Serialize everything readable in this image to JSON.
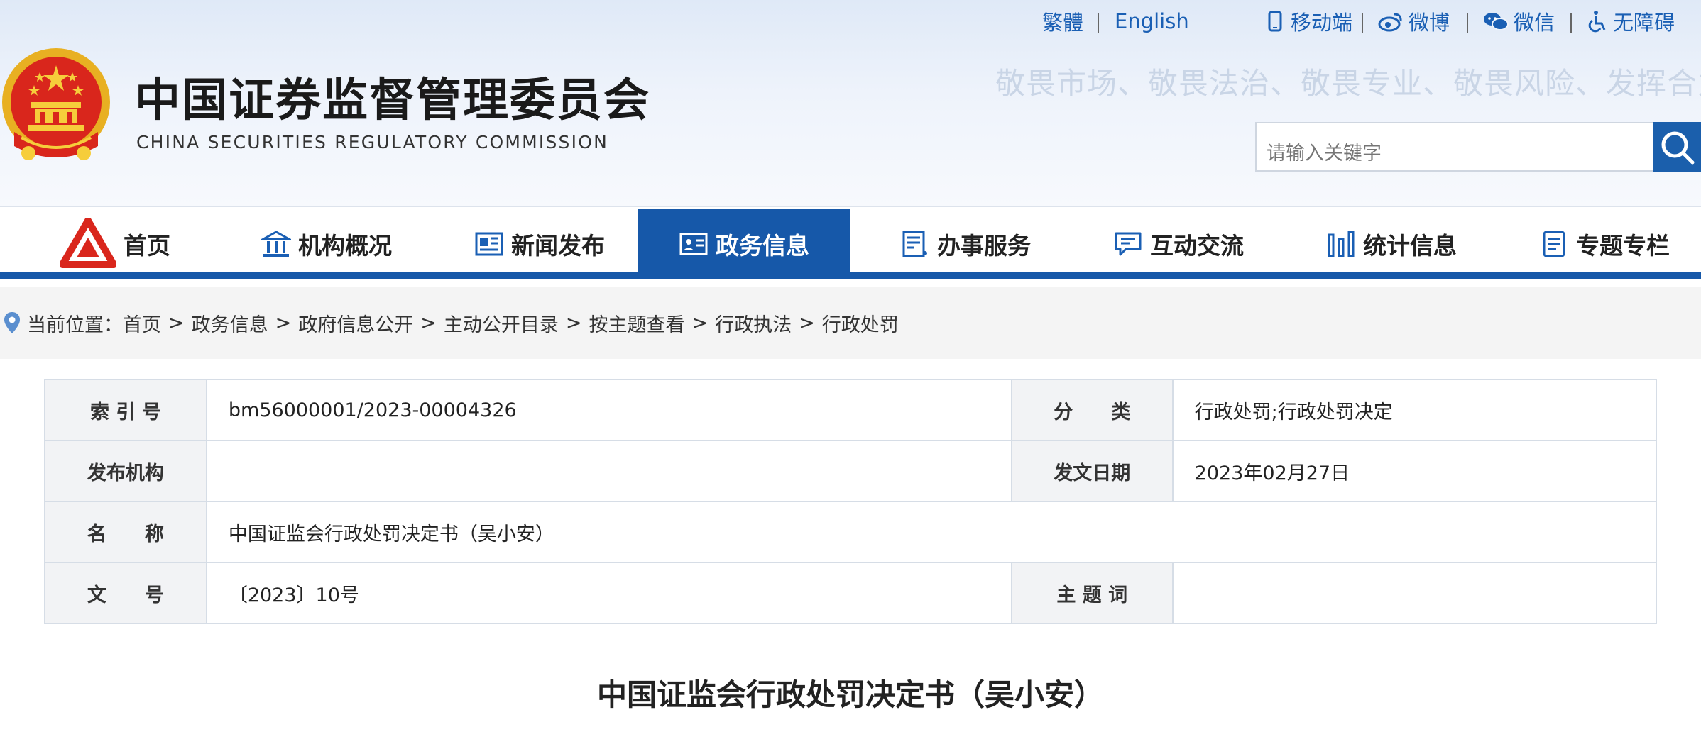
{
  "header": {
    "title_cn": "中国证券监督管理委员会",
    "title_en": "CHINA SECURITIES REGULATORY COMMISSION",
    "slogan": "敬畏市场、敬畏法治、敬畏专业、敬畏风险、发挥合力",
    "top_links": {
      "traditional": "繁體",
      "english": "English",
      "mobile": "移动端",
      "weibo": "微博",
      "wechat": "微信",
      "accessibility": "无障碍"
    },
    "search_placeholder": "请输入关键字"
  },
  "nav": {
    "items": [
      {
        "label": "首页",
        "icon": "csrc-logo-icon"
      },
      {
        "label": "机构概况",
        "icon": "building-icon"
      },
      {
        "label": "新闻发布",
        "icon": "newspaper-icon"
      },
      {
        "label": "政务信息",
        "icon": "id-card-icon",
        "active": true
      },
      {
        "label": "办事服务",
        "icon": "service-doc-icon"
      },
      {
        "label": "互动交流",
        "icon": "chat-bubble-icon"
      },
      {
        "label": "统计信息",
        "icon": "bar-chart-icon"
      },
      {
        "label": "专题专栏",
        "icon": "document-icon"
      }
    ],
    "active_color": "#1658a9"
  },
  "breadcrumb": {
    "prefix": "当前位置：",
    "items": [
      "首页",
      "政务信息",
      "政府信息公开",
      "主动公开目录",
      "按主题查看",
      "行政执法",
      "行政处罚"
    ],
    "separator": ">"
  },
  "info": {
    "index_label": "索 引 号",
    "index_value": "bm56000001/2023-00004326",
    "category_label": "分　　类",
    "category_value": "行政处罚;行政处罚决定",
    "issuer_label": "发布机构",
    "issuer_value": "",
    "date_label": "发文日期",
    "date_value": "2023年02月27日",
    "name_label": "名　　称",
    "name_value": "中国证监会行政处罚决定书（吴小安）",
    "docno_label": "文　　号",
    "docno_value": "〔2023〕10号",
    "keywords_label": "主 题 词",
    "keywords_value": ""
  },
  "document": {
    "title": "中国证监会行政处罚决定书（吴小安）"
  },
  "colors": {
    "brand_blue": "#1658a9",
    "link_blue": "#1a5fb4",
    "slogan": "#c9d5e6"
  }
}
